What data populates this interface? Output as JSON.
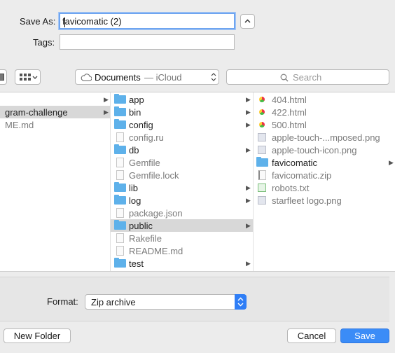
{
  "save_as": {
    "label": "Save As:",
    "value": "favicomatic (2)"
  },
  "tags": {
    "label": "Tags:",
    "value": ""
  },
  "toolbar": {
    "location": "Documents",
    "location_suffix": "— iCloud",
    "search_placeholder": "Search"
  },
  "columns": {
    "col1": [
      {
        "name": "gram-challenge",
        "selected": true,
        "folder": true
      },
      {
        "name": "ME.md",
        "selected": false,
        "folder": false
      }
    ],
    "col2": [
      {
        "name": "app",
        "type": "folder"
      },
      {
        "name": "bin",
        "type": "folder"
      },
      {
        "name": "config",
        "type": "folder"
      },
      {
        "name": "config.ru",
        "type": "file"
      },
      {
        "name": "db",
        "type": "folder"
      },
      {
        "name": "Gemfile",
        "type": "file"
      },
      {
        "name": "Gemfile.lock",
        "type": "file"
      },
      {
        "name": "lib",
        "type": "folder"
      },
      {
        "name": "log",
        "type": "folder"
      },
      {
        "name": "package.json",
        "type": "file"
      },
      {
        "name": "public",
        "type": "folder",
        "selected": true
      },
      {
        "name": "Rakefile",
        "type": "file"
      },
      {
        "name": "README.md",
        "type": "file"
      },
      {
        "name": "test",
        "type": "folder"
      }
    ],
    "col3": [
      {
        "name": "404.html",
        "type": "html"
      },
      {
        "name": "422.html",
        "type": "html"
      },
      {
        "name": "500.html",
        "type": "html"
      },
      {
        "name": "apple-touch-...mposed.png",
        "type": "image"
      },
      {
        "name": "apple-touch-icon.png",
        "type": "image"
      },
      {
        "name": "favicomatic",
        "type": "folder"
      },
      {
        "name": "favicomatic.zip",
        "type": "zip"
      },
      {
        "name": "robots.txt",
        "type": "text"
      },
      {
        "name": "starfleet logo.png",
        "type": "image"
      }
    ]
  },
  "format": {
    "label": "Format:",
    "value": "Zip archive"
  },
  "buttons": {
    "new_folder": "New Folder",
    "cancel": "Cancel",
    "save": "Save"
  },
  "colors": {
    "accent": "#2f7ef6",
    "folder": "#5eb1ea",
    "selection": "#d8d8d8"
  }
}
